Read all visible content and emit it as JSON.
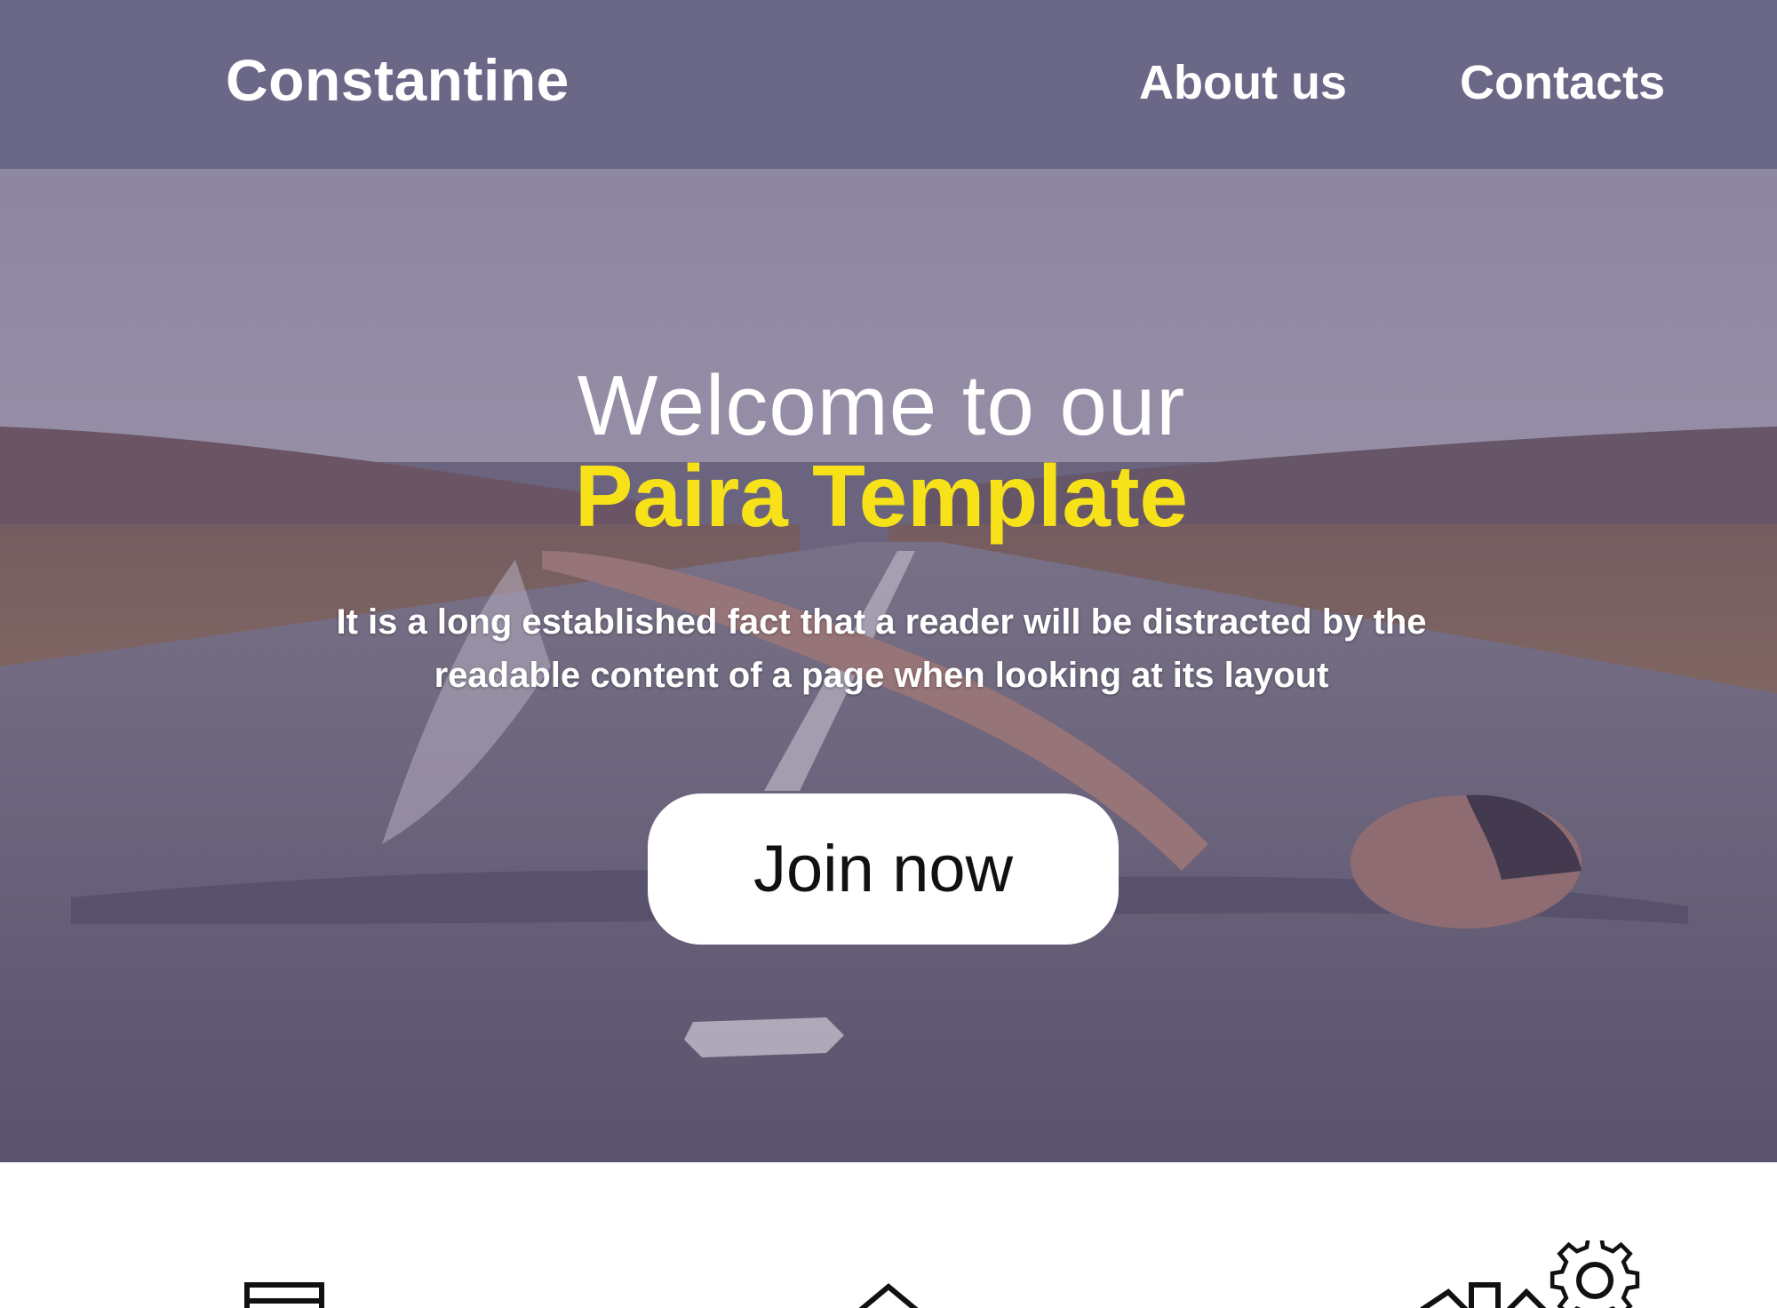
{
  "header": {
    "brand": "Constantine",
    "nav": [
      {
        "label": "About us"
      },
      {
        "label": "Contacts"
      }
    ]
  },
  "hero": {
    "title_line1": "Welcome to our",
    "title_line2": "Paira Template",
    "description": "It is a long established fact that a reader will be distracted by the readable content of a page when looking at its layout",
    "cta_label": "Join now"
  },
  "features": {
    "icons": [
      "document-icon",
      "house-icon",
      "gear-icon"
    ]
  },
  "colors": {
    "header_bg": "#6a6787",
    "accent_yellow": "#f7e21a",
    "button_bg": "#ffffff"
  }
}
